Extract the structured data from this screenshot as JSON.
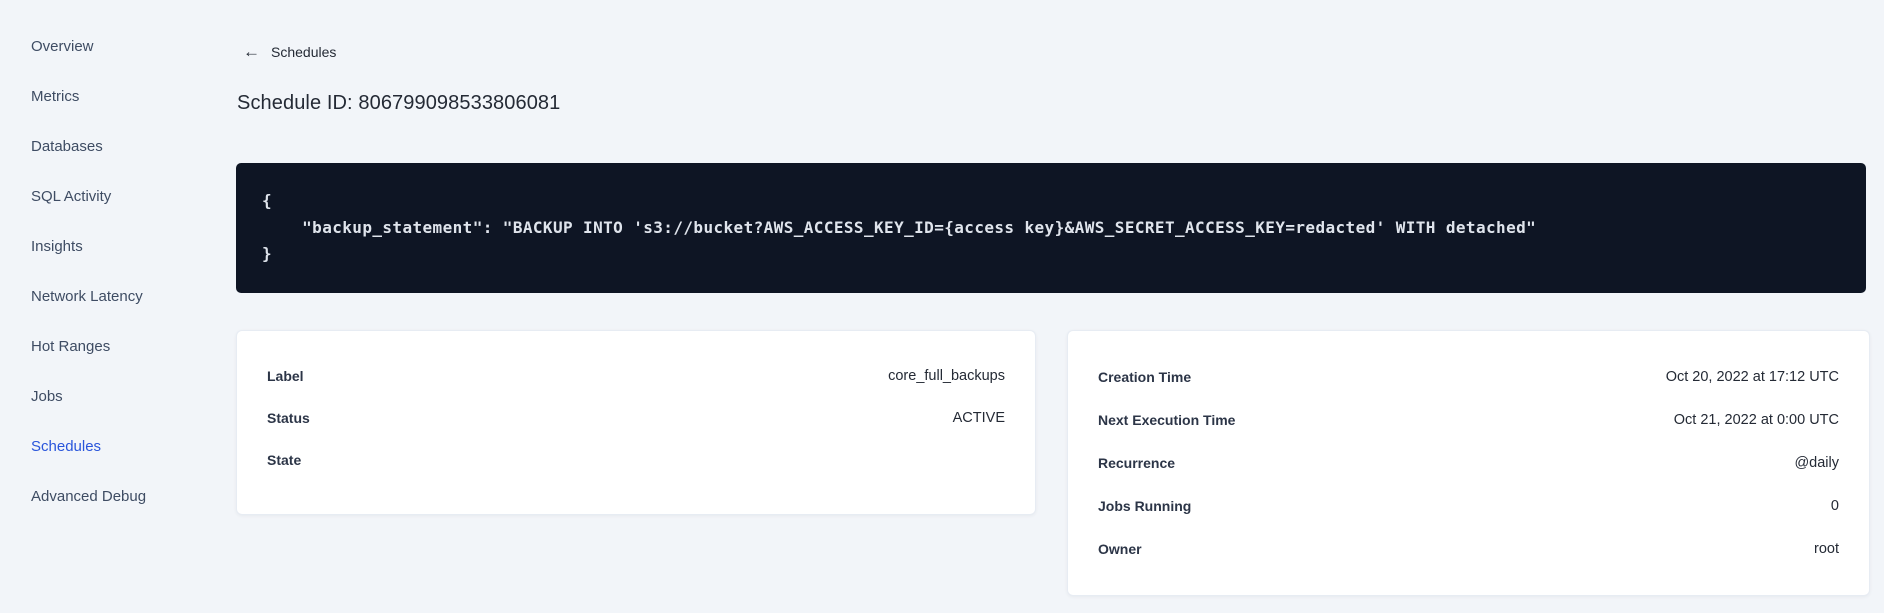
{
  "sidebar": {
    "items": [
      {
        "label": "Overview",
        "active": false
      },
      {
        "label": "Metrics",
        "active": false
      },
      {
        "label": "Databases",
        "active": false
      },
      {
        "label": "SQL Activity",
        "active": false
      },
      {
        "label": "Insights",
        "active": false
      },
      {
        "label": "Network Latency",
        "active": false
      },
      {
        "label": "Hot Ranges",
        "active": false
      },
      {
        "label": "Jobs",
        "active": false
      },
      {
        "label": "Schedules",
        "active": true
      },
      {
        "label": "Advanced Debug",
        "active": false
      }
    ],
    "active_color": "#2955db",
    "text_color": "#3e4c63"
  },
  "header": {
    "back_icon_glyph": "←",
    "back_label": "Schedules",
    "title": "Schedule ID: 806799098533806081"
  },
  "code_block": {
    "background_color": "#0e1524",
    "text_color": "#dfe4ec",
    "lines": [
      "{",
      "    \"backup_statement\": \"BACKUP INTO 's3://bucket?AWS_ACCESS_KEY_ID={access key}&AWS_SECRET_ACCESS_KEY=redacted' WITH detached\"",
      "}"
    ]
  },
  "cards": {
    "left": {
      "rows": [
        {
          "label": "Label",
          "value": "core_full_backups"
        },
        {
          "label": "Status",
          "value": "ACTIVE"
        },
        {
          "label": "State",
          "value": ""
        }
      ]
    },
    "right": {
      "rows": [
        {
          "label": "Creation Time",
          "value": "Oct 20, 2022 at 17:12 UTC"
        },
        {
          "label": "Next Execution Time",
          "value": "Oct 21, 2022 at 0:00 UTC"
        },
        {
          "label": "Recurrence",
          "value": "@daily"
        },
        {
          "label": "Jobs Running",
          "value": "0"
        },
        {
          "label": "Owner",
          "value": "root"
        }
      ]
    }
  }
}
